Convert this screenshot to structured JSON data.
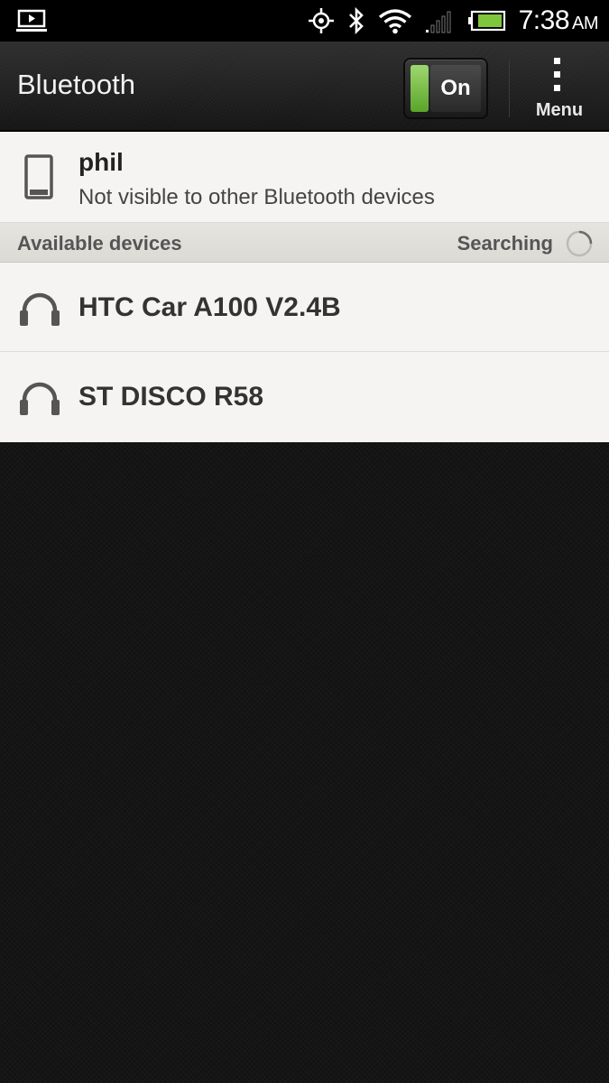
{
  "status_bar": {
    "time": "7:38",
    "ampm": "AM",
    "icons": [
      "screen-cast-icon",
      "gps-icon",
      "bluetooth-icon",
      "wifi-icon",
      "signal-icon",
      "battery-icon"
    ]
  },
  "action_bar": {
    "title": "Bluetooth",
    "toggle_label": "On",
    "menu_label": "Menu"
  },
  "this_device": {
    "name": "phil",
    "visibility": "Not visible to other Bluetooth devices",
    "icon": "phone-icon"
  },
  "available_section": {
    "title": "Available devices",
    "status": "Searching"
  },
  "devices": [
    {
      "name": "HTC Car A100 V2.4B",
      "icon": "headphones-icon"
    },
    {
      "name": "ST DISCO R58",
      "icon": "headphones-icon"
    }
  ],
  "colors": {
    "toggle_on": "#6cba3a",
    "panel_bg": "#f4f3f1",
    "background": "#151515"
  }
}
